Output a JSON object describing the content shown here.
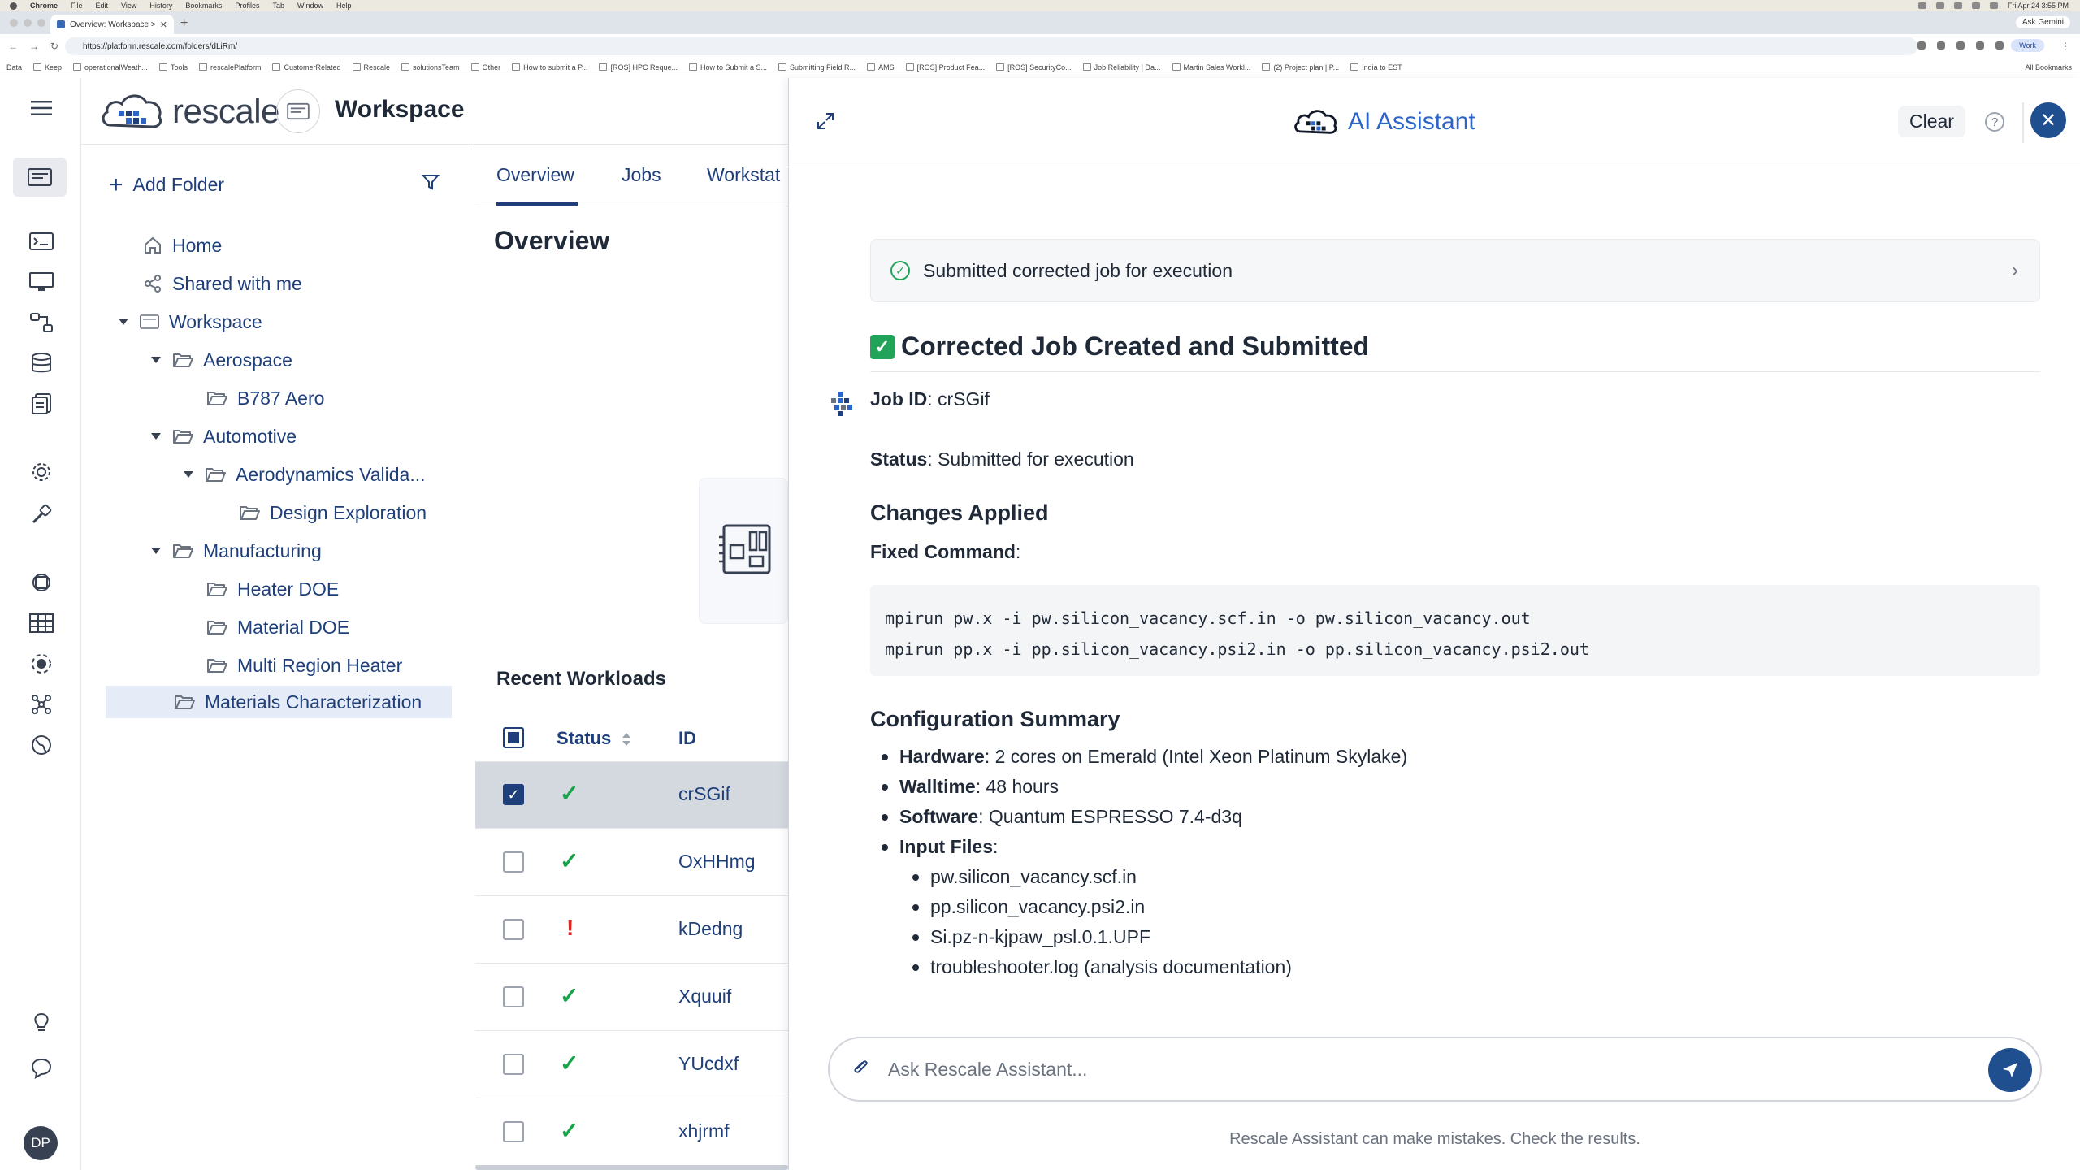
{
  "os_menubar": {
    "items": [
      "Chrome",
      "File",
      "Edit",
      "View",
      "History",
      "Bookmarks",
      "Profiles",
      "Tab",
      "Window",
      "Help"
    ],
    "clock": "Fri Apr 24  3:55 PM"
  },
  "browser": {
    "tab_title": "Overview: Workspace > Mat",
    "url": "https://platform.rescale.com/folders/dLiRm/",
    "ask_gemini": "Ask Gemini",
    "profile_label": "Work",
    "bookmarks": [
      "Keep",
      "operationalWeath...",
      "Tools",
      "rescalePlatform",
      "CustomerRelated",
      "Rescale",
      "solutionsTeam",
      "Other",
      "How to submit a P...",
      "[ROS] HPC Reque...",
      "How to Submit a S...",
      "Submitting Field R...",
      "AMS",
      "[ROS] Product Fea...",
      "[ROS] SecurityCo...",
      "Job Reliability | Da...",
      "Martin Sales Workl...",
      "(2) Project plan | P...",
      "India to EST"
    ],
    "bookmarks_leading": "Data",
    "all_bookmarks": "All Bookmarks"
  },
  "app": {
    "logo_text": "rescale",
    "page_title": "Workspace",
    "user_initials": "DP"
  },
  "tree": {
    "add_folder": "Add Folder",
    "home": "Home",
    "shared": "Shared with me",
    "workspace": "Workspace",
    "aerospace": "Aerospace",
    "b787": "B787 Aero",
    "automotive": "Automotive",
    "aero_valida": "Aerodynamics Valida...",
    "design_exploration": "Design Exploration",
    "manufacturing": "Manufacturing",
    "heater_doe": "Heater DOE",
    "material_doe": "Material DOE",
    "multi_region": "Multi Region Heater",
    "materials_char": "Materials Characterization"
  },
  "middle": {
    "tabs": [
      "Overview",
      "Jobs",
      "Workstat"
    ],
    "overview_title": "Overview",
    "recent_workloads": "Recent Workloads",
    "col_status": "Status",
    "col_id": "ID",
    "rows": [
      {
        "status": "ok",
        "status_glyph": "✓",
        "id": "crSGif",
        "checked": true
      },
      {
        "status": "ok",
        "status_glyph": "✓",
        "id": "OxHHmg",
        "checked": false
      },
      {
        "status": "err",
        "status_glyph": "!",
        "id": "kDedng",
        "checked": false
      },
      {
        "status": "ok",
        "status_glyph": "✓",
        "id": "Xquuif",
        "checked": false
      },
      {
        "status": "ok",
        "status_glyph": "✓",
        "id": "YUcdxf",
        "checked": false
      },
      {
        "status": "ok",
        "status_glyph": "✓",
        "id": "xhjrmf",
        "checked": false
      }
    ]
  },
  "assistant": {
    "title": "AI Assistant",
    "clear": "Clear",
    "help_glyph": "?",
    "close_glyph": "✕",
    "tool_step": "Submitted corrected job for execution",
    "heading": "Corrected Job Created and Submitted",
    "job_id_label": "Job ID",
    "job_id_value": ": crSGif",
    "status_label": "Status",
    "status_value": ": Submitted for execution",
    "changes_heading": "Changes Applied",
    "fixed_command_label": "Fixed Command",
    "fixed_command_suffix": ":",
    "code_lines": [
      "mpirun pw.x -i pw.silicon_vacancy.scf.in -o pw.silicon_vacancy.out",
      "mpirun pp.x -i pp.silicon_vacancy.psi2.in -o pp.silicon_vacancy.psi2.out"
    ],
    "config_heading": "Configuration Summary",
    "config": [
      {
        "label": "Hardware",
        "value": ": 2 cores on Emerald (Intel Xeon Platinum Skylake)"
      },
      {
        "label": "Walltime",
        "value": ": 48 hours"
      },
      {
        "label": "Software",
        "value": ": Quantum ESPRESSO 7.4-d3q"
      },
      {
        "label": "Input Files",
        "value": ":"
      }
    ],
    "input_files": [
      "pw.silicon_vacancy.scf.in",
      "pp.silicon_vacancy.psi2.in",
      "Si.pz-n-kjpaw_psl.0.1.UPF",
      "troubleshooter.log (analysis documentation)"
    ],
    "input_placeholder": "Ask Rescale Assistant...",
    "disclaimer": "Rescale Assistant can make mistakes. Check the results."
  },
  "colors": {
    "brand_navy": "#1f3f7a",
    "accent_blue": "#2c64c8",
    "button_navy": "#1f4f8f",
    "success_green": "#16a34a",
    "error_red": "#dc2626"
  },
  "icons": {
    "rail": [
      "menu-icon",
      "workspace-icon",
      "terminal-icon",
      "desktop-icon",
      "workflow-icon",
      "storage-icon",
      "files-icon",
      "settings-icon",
      "tools-icon",
      "chip-icon",
      "table-icon",
      "plugin-icon",
      "network-icon",
      "globe-icon",
      "lightbulb-icon",
      "chat-icon"
    ]
  }
}
